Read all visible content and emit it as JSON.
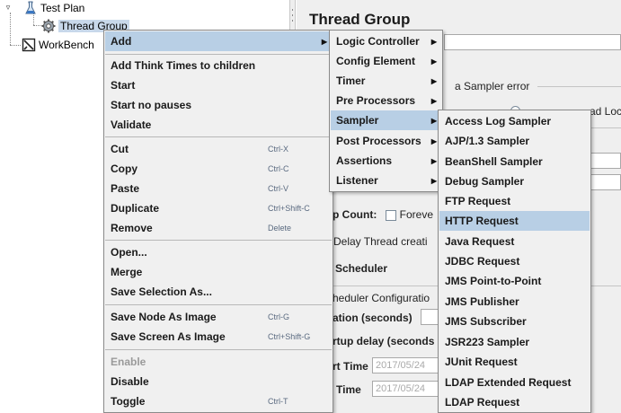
{
  "tree": {
    "test_plan": "Test Plan",
    "thread_group": "Thread Group",
    "workbench": "WorkBench"
  },
  "panel": {
    "title": "Thread Group",
    "sampler_error_fragment": "a Sampler error",
    "next_thread_fragment": "ad Loc",
    "loop_count_fragment": "p Count:",
    "forever_fragment": "Foreve",
    "delay_fragment": "Delay Thread creati",
    "scheduler_label": "Scheduler",
    "scheduler_config_fragment": "heduler Configuratio",
    "duration_fragment": "ation (seconds)",
    "startup_delay_fragment": "rtup delay (seconds",
    "start_time_fragment": "rt Time",
    "start_time_value": "2017/05/24",
    "end_time_fragment": "Time",
    "end_time_value": "2017/05/24"
  },
  "context_menu": {
    "items": [
      {
        "label": "Add",
        "shortcut": "",
        "submenu": true,
        "highlighted": true
      },
      {
        "label": "Add Think Times to children",
        "shortcut": ""
      },
      {
        "label": "Start",
        "shortcut": ""
      },
      {
        "label": "Start no pauses",
        "shortcut": ""
      },
      {
        "label": "Validate",
        "shortcut": ""
      },
      {
        "label": "Cut",
        "shortcut": "Ctrl-X"
      },
      {
        "label": "Copy",
        "shortcut": "Ctrl-C"
      },
      {
        "label": "Paste",
        "shortcut": "Ctrl-V"
      },
      {
        "label": "Duplicate",
        "shortcut": "Ctrl+Shift-C"
      },
      {
        "label": "Remove",
        "shortcut": "Delete"
      },
      {
        "label": "Open...",
        "shortcut": ""
      },
      {
        "label": "Merge",
        "shortcut": ""
      },
      {
        "label": "Save Selection As...",
        "shortcut": ""
      },
      {
        "label": "Save Node As Image",
        "shortcut": "Ctrl-G"
      },
      {
        "label": "Save Screen As Image",
        "shortcut": "Ctrl+Shift-G"
      },
      {
        "label": "Enable",
        "shortcut": "",
        "disabled": true
      },
      {
        "label": "Disable",
        "shortcut": ""
      },
      {
        "label": "Toggle",
        "shortcut": "Ctrl-T"
      }
    ]
  },
  "add_menu": {
    "items": [
      {
        "label": "Logic Controller",
        "submenu": true
      },
      {
        "label": "Config Element",
        "submenu": true
      },
      {
        "label": "Timer",
        "submenu": true
      },
      {
        "label": "Pre Processors",
        "submenu": true
      },
      {
        "label": "Sampler",
        "submenu": true,
        "highlighted": true
      },
      {
        "label": "Post Processors",
        "submenu": true
      },
      {
        "label": "Assertions",
        "submenu": true
      },
      {
        "label": "Listener",
        "submenu": true
      }
    ]
  },
  "sampler_menu": {
    "items": [
      {
        "label": "Access Log Sampler"
      },
      {
        "label": "AJP/1.3 Sampler"
      },
      {
        "label": "BeanShell Sampler"
      },
      {
        "label": "Debug Sampler"
      },
      {
        "label": "FTP Request"
      },
      {
        "label": "HTTP Request",
        "highlighted": true
      },
      {
        "label": "Java Request"
      },
      {
        "label": "JDBC Request"
      },
      {
        "label": "JMS Point-to-Point"
      },
      {
        "label": "JMS Publisher"
      },
      {
        "label": "JMS Subscriber"
      },
      {
        "label": "JSR223 Sampler"
      },
      {
        "label": "JUnit Request"
      },
      {
        "label": "LDAP Extended Request"
      },
      {
        "label": "LDAP Request"
      }
    ]
  },
  "icons": {
    "submenu_arrow": "triangle-right",
    "test_plan": "flask-icon",
    "thread_group": "gear-icon",
    "workbench": "workbench-icon"
  },
  "colors": {
    "highlight": "#b8cfe5",
    "menu_bg": "#f0f0f0",
    "panel_bg": "#efefef",
    "selected_node": "#c8d8ea"
  }
}
